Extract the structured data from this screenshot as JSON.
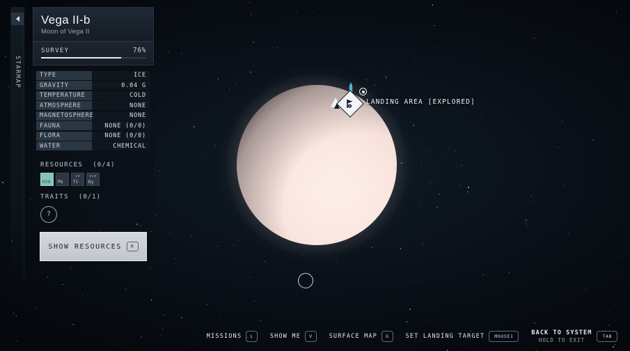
{
  "rail": {
    "back_icon": "back-arrow-icon",
    "label": "STARMAP"
  },
  "panel": {
    "title": "Vega II-b",
    "subtitle": "Moon of Vega II",
    "survey": {
      "label": "SURVEY",
      "percent_text": "76%",
      "percent_value": 76
    },
    "stats": [
      {
        "key": "TYPE",
        "value": "ICE"
      },
      {
        "key": "GRAVITY",
        "value": "0.04 G"
      },
      {
        "key": "TEMPERATURE",
        "value": "COLD"
      },
      {
        "key": "ATMOSPHERE",
        "value": "NONE"
      },
      {
        "key": "MAGNETOSPHERE",
        "value": "NONE"
      },
      {
        "key": "FAUNA",
        "value": "NONE (0/0)"
      },
      {
        "key": "FLORA",
        "value": "NONE (0/0)"
      },
      {
        "key": "WATER",
        "value": "CHEMICAL"
      }
    ],
    "resources": {
      "label": "RESOURCES",
      "count": "(0/4)",
      "tiles": [
        {
          "symbol": "H2O",
          "glyph": "",
          "active": true
        },
        {
          "symbol": "Pb",
          "glyph": "",
          "active": false
        },
        {
          "symbol": "Ti",
          "glyph": "••",
          "active": false
        },
        {
          "symbol": "Dy",
          "glyph": "•••",
          "active": false
        }
      ]
    },
    "traits": {
      "label": "TRAITS",
      "count": "(0/1)",
      "unknown_glyph": "?"
    },
    "show_resources": {
      "label": "SHOW RESOURCES",
      "key": "R"
    }
  },
  "map": {
    "landing_marker": {
      "label": "LANDING AREA [EXPLORED]",
      "icon": "landing-flag-diamond-icon",
      "ship_icon": "ship-pin-icon",
      "player_icon": "player-arrow-icon",
      "target_icon": "target-dot-icon"
    },
    "secondary_body_icon": "orbit-circle-icon"
  },
  "bottom_bar": {
    "hints": [
      {
        "label": "MISSIONS",
        "key": "L"
      },
      {
        "label": "SHOW ME",
        "key": "V"
      },
      {
        "label": "SURFACE MAP",
        "key": "G"
      },
      {
        "label": "SET LANDING TARGET",
        "key": "MOUSE1"
      }
    ],
    "exit": {
      "main": "BACK TO SYSTEM",
      "sub": "HOLD TO EXIT",
      "key": "TAB"
    }
  },
  "colors": {
    "background": "#070d14",
    "accent_resource": "#84c4b8",
    "panel_head": "#202a36",
    "text_primary": "#f0f4f8",
    "text_muted": "#97a5b2",
    "planet": "#fbe7e1"
  }
}
